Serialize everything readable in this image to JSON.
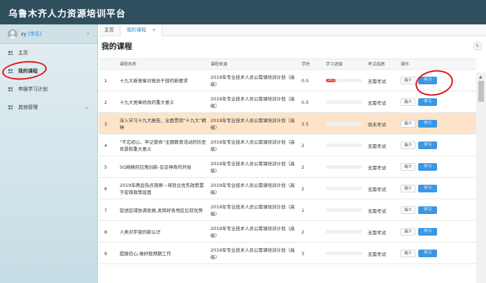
{
  "app": {
    "title": "乌鲁木齐人力资源培训平台"
  },
  "user": {
    "name": "zy",
    "role": "[学员]"
  },
  "sidebar": {
    "items": [
      {
        "label": "主页"
      },
      {
        "label": "我的课程"
      },
      {
        "label": "申报学习计划"
      },
      {
        "label": "其他管理"
      }
    ]
  },
  "tabs": {
    "home": "主页",
    "current": "我的课程",
    "close": "×"
  },
  "page": {
    "title": "我的课程",
    "refresh_icon": "↻"
  },
  "table": {
    "headers": [
      "课程名称",
      "课程来源",
      "学时",
      "学习进度",
      "考试成绩",
      "操作"
    ],
    "rows": [
      {
        "no": "1",
        "name": "十九大新党章对党员干部的新要求",
        "source": "2019年专业技术人员公需课培训计划（高级）",
        "hours": "0.5",
        "progress": 0.26,
        "progress_label": "26.1",
        "exam": "无需考试"
      },
      {
        "no": "2",
        "name": "十九大党章修改的重大意义",
        "source": "2019年专业技术人员公需课培训计划（高级）",
        "hours": "0.5",
        "progress": 0,
        "progress_label": "",
        "exam": "无需考试"
      },
      {
        "no": "3",
        "name": "深入学习十九大报告，全面贯彻“十九大”精神",
        "source": "2019年专业技术人员公需课培训计划（高级）",
        "hours": "2.5",
        "progress": 0,
        "progress_label": "",
        "exam": "尚未考试"
      },
      {
        "no": "4",
        "name": "“不忘初心、牢记使命”主题教育活动的历史背景和重大意义",
        "source": "2019年专业技术人员公需课培训计划（高级）",
        "hours": "2",
        "progress": 0,
        "progress_label": "",
        "exam": "无需考试"
      },
      {
        "no": "5",
        "name": "5G网络的应用创新-见证神奇的开始",
        "source": "2019年专业技术人员公需课培训计划（高级）",
        "hours": "2",
        "progress": 0,
        "progress_label": "",
        "exam": "无需考试"
      },
      {
        "no": "6",
        "name": "2019年两会热点观察—将就业优先政策置于宏观政策层面",
        "source": "2019年专业技术人员公需课培训计划（高级）",
        "hours": "2",
        "progress": 0,
        "progress_label": "",
        "exam": "无需考试"
      },
      {
        "no": "7",
        "name": "促进区域协调发展,发挥好各地区比较优势",
        "source": "2019年专业技术人员公需课培训计划（高级）",
        "hours": "1",
        "progress": 0,
        "progress_label": "",
        "exam": "无需考试"
      },
      {
        "no": "8",
        "name": "人类对宇宙的新认识",
        "source": "2019年专业技术人员公需课培训计划（高级）",
        "hours": "2",
        "progress": 0,
        "progress_label": "",
        "exam": "无需考试"
      },
      {
        "no": "9",
        "name": "提振信心,做好稳预期工作",
        "source": "2019年专业技术人员公需课培训计划（高级）",
        "hours": "3",
        "progress": 0,
        "progress_label": "",
        "exam": "无需考试"
      }
    ],
    "actions": {
      "intro": "简介",
      "study": "学习"
    }
  },
  "colors": {
    "header": "#2f4f5f",
    "accent": "#3b97e3",
    "highlight_row": "#fde4c8",
    "annotation": "#e3101a"
  }
}
